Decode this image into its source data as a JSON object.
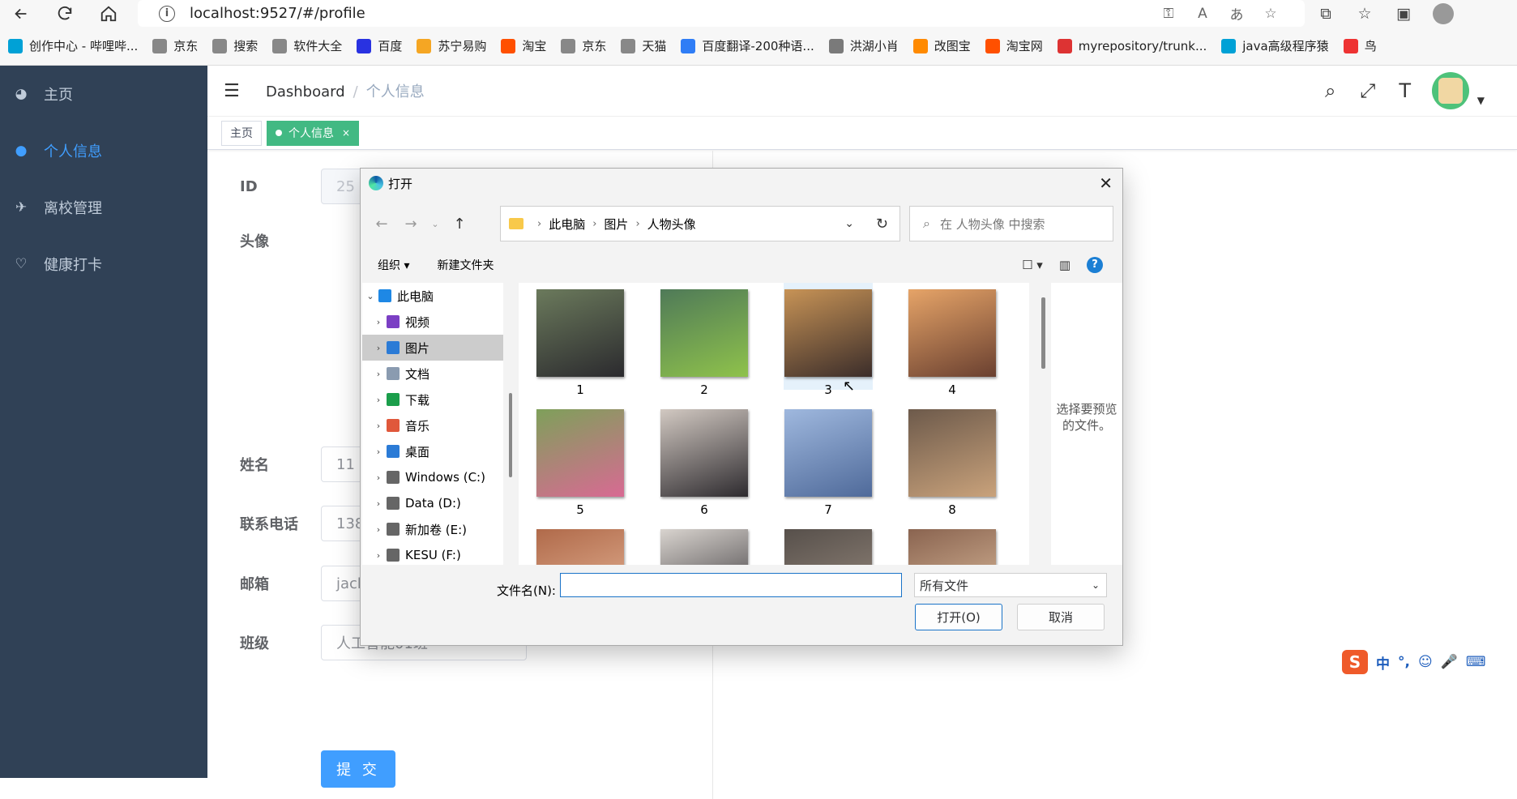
{
  "browser": {
    "url": "localhost:9527/#/profile"
  },
  "bookmarks": [
    {
      "label": "创作中心 - 哔哩哔...",
      "color": "#00a1d6"
    },
    {
      "label": "京东",
      "color": "#888"
    },
    {
      "label": "搜索",
      "color": "#888"
    },
    {
      "label": "软件大全",
      "color": "#888"
    },
    {
      "label": "百度",
      "color": "#2932e1"
    },
    {
      "label": "苏宁易购",
      "color": "#f5a623"
    },
    {
      "label": "淘宝",
      "color": "#ff5000"
    },
    {
      "label": "京东",
      "color": "#888"
    },
    {
      "label": "天猫",
      "color": "#888"
    },
    {
      "label": "百度翻译-200种语...",
      "color": "#2f7df6"
    },
    {
      "label": "洪湖小肖",
      "color": "#7a7a7a"
    },
    {
      "label": "改图宝",
      "color": "#ff8a00"
    },
    {
      "label": "淘宝网",
      "color": "#ff5000"
    },
    {
      "label": "myrepository/trunk...",
      "color": "#d33"
    },
    {
      "label": "java高级程序猿",
      "color": "#00a1d6"
    },
    {
      "label": "鸟",
      "color": "#e33"
    }
  ],
  "sidebar": {
    "items": [
      {
        "label": "主页",
        "icon": "dashboard-icon"
      },
      {
        "label": "个人信息",
        "icon": "user-icon"
      },
      {
        "label": "离校管理",
        "icon": "run-icon"
      },
      {
        "label": "健康打卡",
        "icon": "heart-icon"
      }
    ]
  },
  "navbar": {
    "breadcrumb_root": "Dashboard",
    "breadcrumb_current": "个人信息"
  },
  "tags": {
    "home": "主页",
    "active": "个人信息"
  },
  "form": {
    "id_label": "ID",
    "id_value": "25",
    "avatar_label": "头像",
    "name_label": "姓名",
    "name_value": "11",
    "phone_label": "联系电话",
    "phone_value": "138",
    "email_label": "邮箱",
    "email_value": "jack",
    "class_label": "班级",
    "class_value": "人工智能01班",
    "submit_label": "提 交"
  },
  "dialog": {
    "title": "打开",
    "path": [
      "此电脑",
      "图片",
      "人物头像"
    ],
    "search_placeholder": "在 人物头像 中搜索",
    "organize": "组织 ▾",
    "new_folder": "新建文件夹",
    "tree": [
      {
        "label": "此电脑",
        "expanded": true,
        "color": "#1e88e5"
      },
      {
        "label": "视频",
        "color": "#7b3fc4"
      },
      {
        "label": "图片",
        "color": "#2b7bd6",
        "selected": true
      },
      {
        "label": "文档",
        "color": "#8a9bb0"
      },
      {
        "label": "下载",
        "color": "#1b9e4b"
      },
      {
        "label": "音乐",
        "color": "#e0583b"
      },
      {
        "label": "桌面",
        "color": "#2b7bd6"
      },
      {
        "label": "Windows (C:)",
        "color": "#666"
      },
      {
        "label": "Data (D:)",
        "color": "#666"
      },
      {
        "label": "新加卷 (E:)",
        "color": "#666"
      },
      {
        "label": "KESU (F:)",
        "color": "#666"
      }
    ],
    "files": [
      {
        "name": "1",
        "c1": "#6b7a5c",
        "c2": "#2b2a2e"
      },
      {
        "name": "2",
        "c1": "#4f7a58",
        "c2": "#8fc24b"
      },
      {
        "name": "3",
        "c1": "#c79356",
        "c2": "#3b2d2a",
        "selected": true
      },
      {
        "name": "4",
        "c1": "#e6a468",
        "c2": "#6a4030"
      },
      {
        "name": "5",
        "c1": "#7ea05a",
        "c2": "#d86a93"
      },
      {
        "name": "6",
        "c1": "#d2c9c2",
        "c2": "#2e2b2f"
      },
      {
        "name": "7",
        "c1": "#9fb8de",
        "c2": "#4f6a9a"
      },
      {
        "name": "8",
        "c1": "#6d5a4b",
        "c2": "#c9a27b"
      },
      {
        "name": "",
        "c1": "#b06a4a",
        "c2": "#e8b89a"
      },
      {
        "name": "",
        "c1": "#d9d4cf",
        "c2": "#2e2b2f"
      },
      {
        "name": "",
        "c1": "#57504b",
        "c2": "#9a8c80"
      },
      {
        "name": "",
        "c1": "#8a6450",
        "c2": "#e0c0a0"
      }
    ],
    "preview_text": "选择要预览的文件。",
    "filename_label": "文件名(N):",
    "filename_value": "",
    "filetype": "所有文件",
    "open_label": "打开(O)",
    "cancel_label": "取消"
  },
  "ime": {
    "logo": "S",
    "mode": "中"
  }
}
